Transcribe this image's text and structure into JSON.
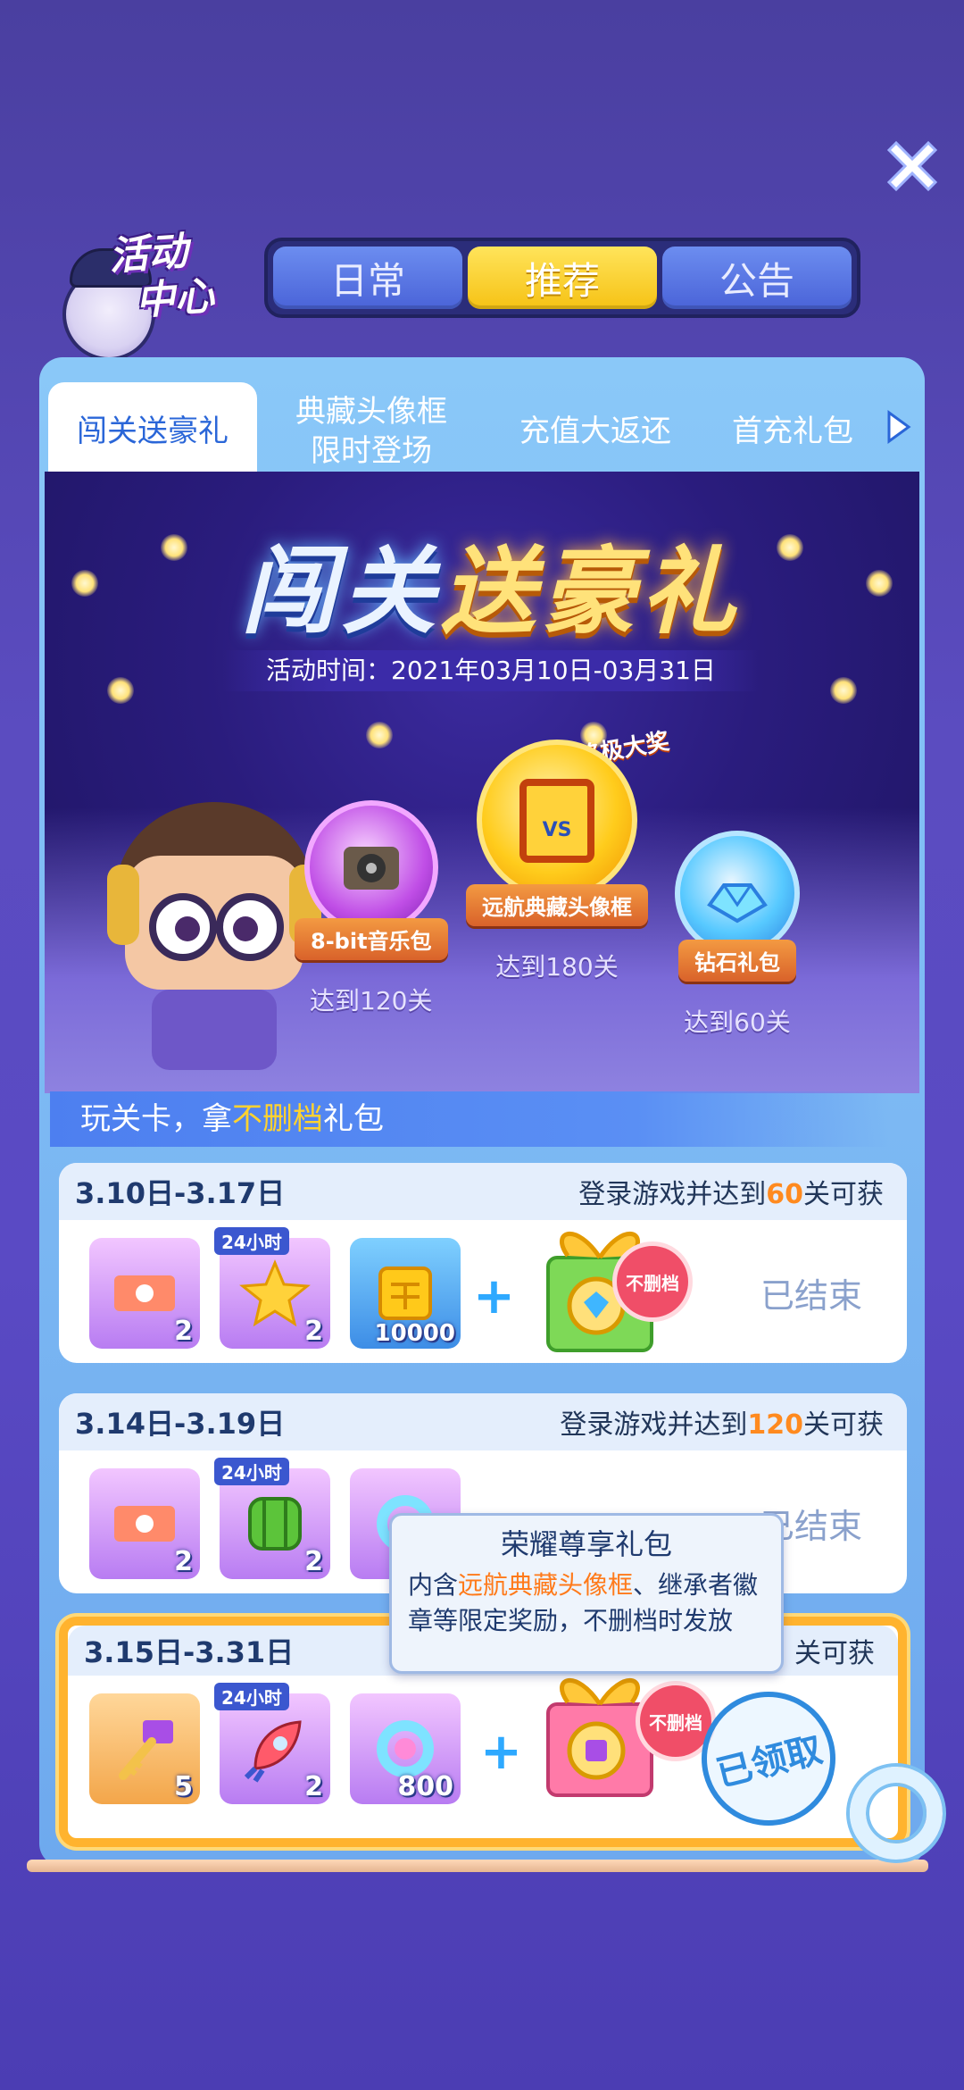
{
  "top_tabs": [
    {
      "label": "日常",
      "active": false
    },
    {
      "label": "推荐",
      "active": true
    },
    {
      "label": "公告",
      "active": false
    }
  ],
  "logo": {
    "line1": "活动",
    "line2": "中心"
  },
  "sub_tabs": [
    {
      "label": "闯关送豪礼",
      "active": true
    },
    {
      "label": "典藏头像框\n限时登场",
      "active": false
    },
    {
      "label": "充值大返还",
      "active": false
    },
    {
      "label": "首充礼包",
      "active": false
    }
  ],
  "banner": {
    "title_part1": "闯关",
    "title_part2": "送豪礼",
    "date": "活动时间：2021年03月10日-03月31日",
    "champion_label": "终极大奖",
    "prizes": [
      {
        "name": "8-bit音乐包",
        "condition": "达到120关"
      },
      {
        "name": "远航典藏头像框",
        "condition": "达到180关"
      },
      {
        "name": "钻石礼包",
        "condition": "达到60关"
      }
    ]
  },
  "section": {
    "title_prefix": "玩关卡，拿",
    "title_highlight": "不删档",
    "title_suffix": "礼包"
  },
  "cards": [
    {
      "date": "3.10日-3.17日",
      "cond_prefix": "登录游戏并达到",
      "cond_num": "60",
      "cond_suffix": "关可获",
      "items": [
        {
          "icon": "ticket-icon",
          "qty": "2",
          "badge": ""
        },
        {
          "icon": "star-icon",
          "qty": "2",
          "badge": "24小时"
        },
        {
          "icon": "coin-block-icon",
          "qty": "10000",
          "badge": ""
        }
      ],
      "gift_tag": "不删档",
      "status": "已结束"
    },
    {
      "date": "3.14日-3.19日",
      "cond_prefix": "登录游戏并达到",
      "cond_num": "120",
      "cond_suffix": "关可获",
      "items": [
        {
          "icon": "ticket-icon",
          "qty": "2",
          "badge": ""
        },
        {
          "icon": "watermelon-icon",
          "qty": "2",
          "badge": "24小时"
        },
        {
          "icon": "ring-icon",
          "qty": "",
          "badge": ""
        }
      ],
      "gift_tag": "",
      "status": "已结束"
    },
    {
      "date": "3.15日-3.31日",
      "cond_prefix": "",
      "cond_num": "",
      "cond_suffix": "关可获",
      "items": [
        {
          "icon": "key-icon",
          "qty": "5",
          "badge": ""
        },
        {
          "icon": "rocket-icon",
          "qty": "2",
          "badge": "24小时"
        },
        {
          "icon": "ring-icon",
          "qty": "800",
          "badge": ""
        }
      ],
      "gift_tag": "不删档",
      "status": "已领取"
    }
  ],
  "tooltip": {
    "title": "荣耀尊享礼包",
    "body_prefix": "内含",
    "body_highlight": "远航典藏头像框",
    "body_suffix": "、继承者徽章等限定奖励，不删档时发放"
  }
}
